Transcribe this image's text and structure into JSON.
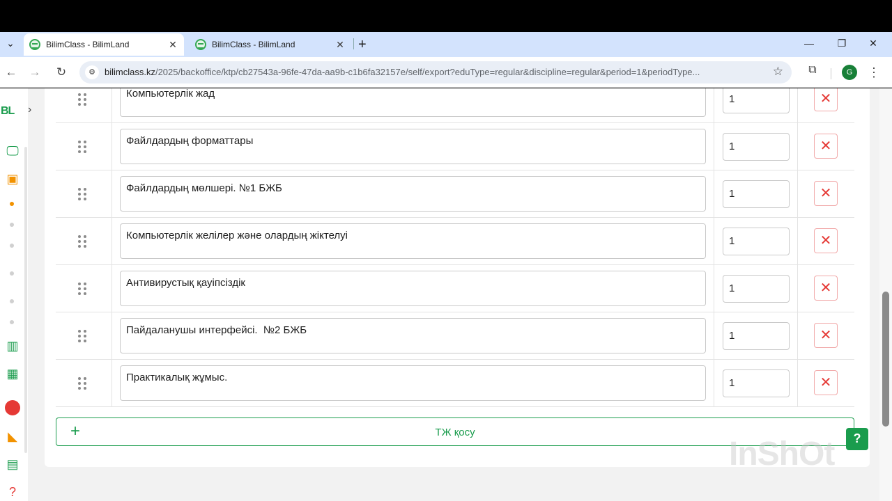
{
  "browser": {
    "tabs": [
      {
        "title": "BilimClass - BilimLand",
        "active": true
      },
      {
        "title": "BilimClass - BilimLand",
        "active": false
      }
    ],
    "url_host": "bilimclass.kz",
    "url_path": "/2025/backoffice/ktp/cb27543a-96fe-47da-aa9b-c1b6fa32157e/self/export?eduType=regular&discipline=regular&period=1&periodType...",
    "profile_initial": "G"
  },
  "sidebar": {
    "logo": "BL"
  },
  "rows": [
    {
      "topic": "Компьютерлік жад",
      "hours": "1"
    },
    {
      "topic": "Файлдардың форматтары",
      "hours": "1"
    },
    {
      "topic": "Файлдардың мөлшері. №1 БЖБ",
      "hours": "1"
    },
    {
      "topic": "Компьютерлік желілер және олардың жіктелуі",
      "hours": "1"
    },
    {
      "topic": "Антивирустық қауіпсіздік",
      "hours": "1"
    },
    {
      "topic": "Пайдаланушы интерфейсі.  №2 БЖБ",
      "hours": "1"
    },
    {
      "topic": "Практикалық жұмыс.",
      "hours": "1"
    }
  ],
  "add_button": {
    "label": "ТЖ қосу"
  },
  "watermark": "InShOt",
  "colors": {
    "brand": "#1a9c4d",
    "delete": "#e53935",
    "accent_dot": "#f29200"
  }
}
